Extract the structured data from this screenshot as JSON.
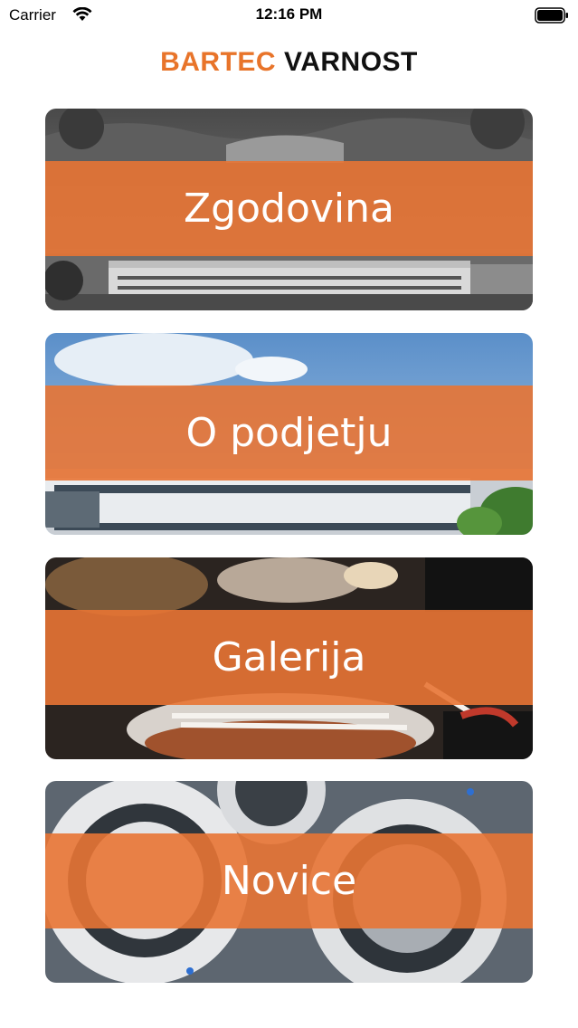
{
  "status_bar": {
    "carrier": "Carrier",
    "time": "12:16 PM"
  },
  "header": {
    "logo_brand": "BARTEC",
    "logo_name": "VARNOST"
  },
  "menu": {
    "items": [
      {
        "label": "Zgodovina"
      },
      {
        "label": "O podjetju"
      },
      {
        "label": "Galerija"
      },
      {
        "label": "Novice"
      }
    ]
  },
  "colors": {
    "accent": "#e8742a"
  }
}
